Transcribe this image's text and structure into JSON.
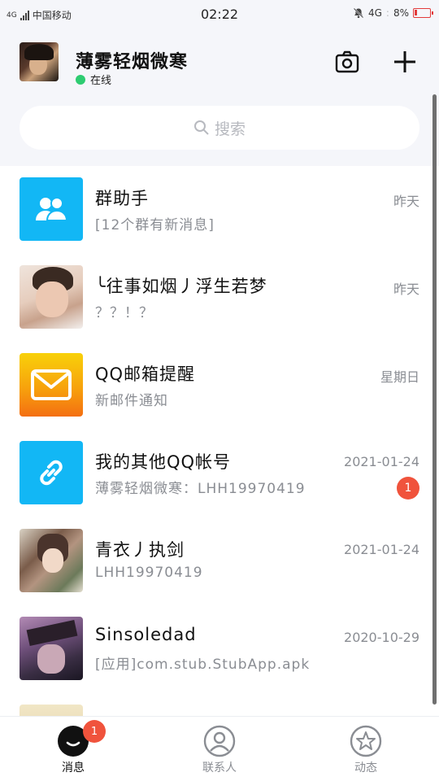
{
  "status_bar": {
    "network_label": "4G",
    "carrier": "中国移动",
    "time": "02:22",
    "network_right": "4G",
    "battery_percent": "8%",
    "icons": [
      "signal-icon",
      "mute-bell-icon",
      "battery-charging-icon"
    ]
  },
  "header": {
    "nickname": "薄雾轻烟微寒",
    "status": "在线",
    "status_color": "#2ecc71",
    "actions": [
      "camera-icon",
      "plus-icon"
    ]
  },
  "search": {
    "placeholder": "搜索"
  },
  "conversations": [
    {
      "title": "群助手",
      "subtitle": "[12个群有新消息]",
      "time": "昨天",
      "badge": ""
    },
    {
      "title": "╰往事如烟丿浮生若梦",
      "subtitle": "？？！？",
      "time": "昨天",
      "badge": ""
    },
    {
      "title": "QQ邮箱提醒",
      "subtitle": "新邮件通知",
      "time": "星期日",
      "badge": ""
    },
    {
      "title": "我的其他QQ帐号",
      "subtitle": "薄雾轻烟微寒：LHH19970419",
      "time": "2021-01-24",
      "badge": "1"
    },
    {
      "title": "青衣丿执剑",
      "subtitle": "LHH19970419",
      "time": "2021-01-24",
      "badge": ""
    },
    {
      "title": "Sinsoledad",
      "subtitle": "[应用]com.stub.StubApp.apk",
      "time": "2020-10-29",
      "badge": ""
    }
  ],
  "tabs": [
    {
      "label": "消息",
      "active": true,
      "badge": "1",
      "icon": "messages-icon"
    },
    {
      "label": "联系人",
      "active": false,
      "badge": "",
      "icon": "contacts-icon"
    },
    {
      "label": "动态",
      "active": false,
      "badge": "",
      "icon": "star-feed-icon"
    }
  ],
  "colors": {
    "accent": "#12b7f5",
    "badge": "#f0533c",
    "header_bg": "#f5f6fa"
  }
}
